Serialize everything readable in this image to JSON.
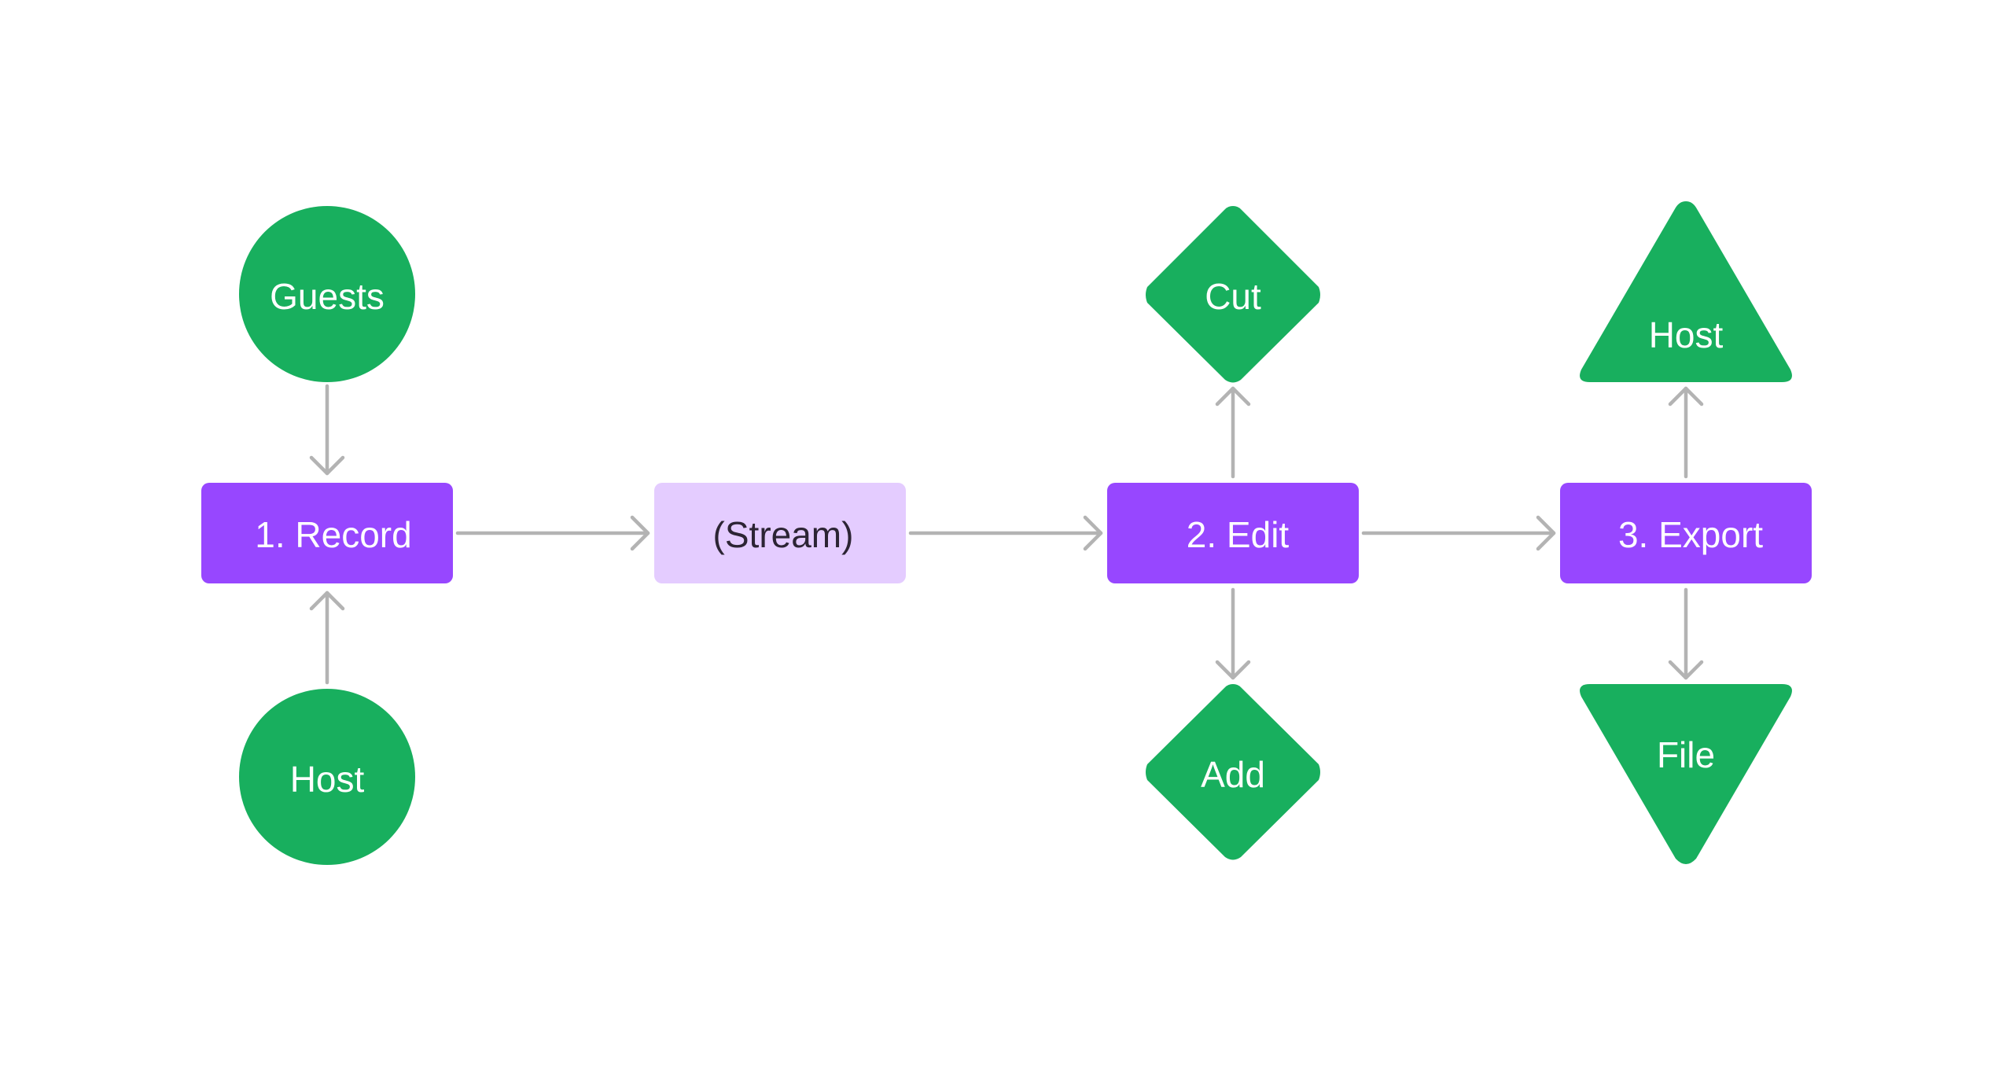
{
  "diagram": {
    "title": "",
    "colors": {
      "background": "#ffffff",
      "process": "#9747ff",
      "process_text": "#ffffff",
      "intermediate": "#e4ccff",
      "intermediate_text": "#2c2434",
      "terminal": "#18af5e",
      "terminal_text": "#ffffff",
      "edge": "#b3b3b3"
    },
    "nodes": [
      {
        "id": "record",
        "label": "1. Record",
        "shape": "rounded-rect",
        "role": "process"
      },
      {
        "id": "stream",
        "label": "(Stream)",
        "shape": "rounded-rect",
        "role": "intermediate"
      },
      {
        "id": "edit",
        "label": "2. Edit",
        "shape": "rounded-rect",
        "role": "process"
      },
      {
        "id": "export",
        "label": "3. Export",
        "shape": "rounded-rect",
        "role": "process"
      },
      {
        "id": "guests",
        "label": "Guests",
        "shape": "circle",
        "role": "terminal"
      },
      {
        "id": "host_in",
        "label": "Host",
        "shape": "circle",
        "role": "terminal"
      },
      {
        "id": "cut",
        "label": "Cut",
        "shape": "diamond",
        "role": "terminal"
      },
      {
        "id": "add",
        "label": "Add",
        "shape": "diamond",
        "role": "terminal"
      },
      {
        "id": "host_out",
        "label": "Host",
        "shape": "triangle-up",
        "role": "terminal"
      },
      {
        "id": "file",
        "label": "File",
        "shape": "triangle-down",
        "role": "terminal"
      }
    ],
    "edges": [
      {
        "from": "guests",
        "to": "record"
      },
      {
        "from": "host_in",
        "to": "record"
      },
      {
        "from": "record",
        "to": "stream"
      },
      {
        "from": "stream",
        "to": "edit"
      },
      {
        "from": "edit",
        "to": "cut"
      },
      {
        "from": "edit",
        "to": "add"
      },
      {
        "from": "edit",
        "to": "export"
      },
      {
        "from": "export",
        "to": "host_out"
      },
      {
        "from": "export",
        "to": "file"
      }
    ]
  }
}
